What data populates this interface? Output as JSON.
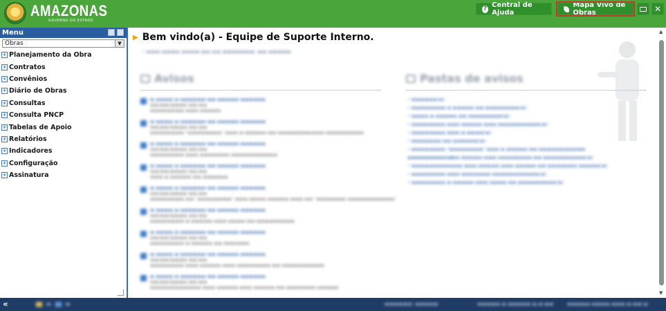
{
  "header": {
    "logo_title": "AMAZONAS",
    "logo_subtitle": "GOVERNO DO ESTADO",
    "help_label": "Central de Ajuda",
    "map_label": "Mapa Vivo de Obras"
  },
  "sidebar": {
    "title": "Menu",
    "select_value": "Obras",
    "items": [
      {
        "label": "Planejamento da Obra"
      },
      {
        "label": "Contratos"
      },
      {
        "label": "Convênios"
      },
      {
        "label": "Diário de Obras"
      },
      {
        "label": "Consultas"
      },
      {
        "label": "Consulta PNCP"
      },
      {
        "label": "Tabelas de Apoio"
      },
      {
        "label": "Relatórios"
      },
      {
        "label": "Indicadores"
      },
      {
        "label": "Configuração"
      },
      {
        "label": "Assinatura"
      }
    ]
  },
  "main": {
    "welcome": "Bem vindo(a) - Equipe de Suporte Interno.",
    "notices_title": "Avisos",
    "folders_title": "Pastas de avisos"
  }
}
